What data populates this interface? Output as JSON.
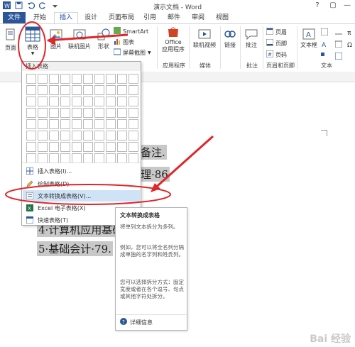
{
  "window": {
    "title": "演示文档 - Word",
    "help": "?",
    "restore": "▢",
    "minimize": "—"
  },
  "tabs": [
    {
      "label": "文件"
    },
    {
      "label": "开始"
    },
    {
      "label": "插入"
    },
    {
      "label": "设计"
    },
    {
      "label": "页面布局"
    },
    {
      "label": "引用"
    },
    {
      "label": "邮件"
    },
    {
      "label": "审阅"
    },
    {
      "label": "视图"
    }
  ],
  "ribbon": {
    "pages_label": "页面",
    "table_label": "表格",
    "picture_label": "图片",
    "online_picture_label": "联机图片",
    "shapes_label": "形状",
    "smartart_label": "SmartArt",
    "chart_label": "图表",
    "screenshot_label": "屏幕截图",
    "office_apps_label": "Office\n应用程序",
    "office_label": "Office",
    "apps_label": "应用程序",
    "online_video_label": "联机视频",
    "link_label": "链接",
    "comment_label": "批注",
    "header_label": "页眉",
    "footer_label": "页脚",
    "page_number_label": "页码",
    "textbox_label": "文本框",
    "group_apps": "应用程序",
    "group_media": "媒体",
    "group_comments": "批注",
    "group_header_footer": "页眉和页脚",
    "group_text": "文本"
  },
  "dropdown": {
    "header": "插入表格",
    "items": [
      {
        "label": "插入表格(I)..."
      },
      {
        "label": "绘制表格(D)"
      },
      {
        "label": "文本转换成表格(V)..."
      },
      {
        "label": "Excel 电子表格(X)"
      },
      {
        "label": "快速表格(T)"
      }
    ]
  },
  "document": {
    "line1": "备注.",
    "line2": "理·86",
    "line3": "4·计算机应用基础",
    "line4": "5·基础会计·79."
  },
  "tooltip": {
    "title": "文本转换成表格",
    "p1": "将单列文本拆分为多列。",
    "p2": "例如，您可以将全名列分隔成单独的名字列和姓氏列。",
    "p3": "您可以选择拆分方式：固定宽度或者在各个逗号、句点或其他字符处拆分。",
    "link": "详细信息"
  },
  "watermark": "Bai 经验"
}
